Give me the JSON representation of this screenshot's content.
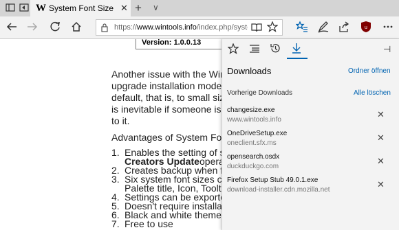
{
  "tab": {
    "logo": "W",
    "title": "System Font Size Chang"
  },
  "toolbar": {
    "tab_icons": [
      "tabs-aside-icon",
      "tab-preview-icon"
    ],
    "new_tab": "+",
    "tab_dropdown": "∨",
    "close_tab": "✕"
  },
  "address": {
    "prefix": "https://",
    "host": "www.wintools.info",
    "path": "/index.php/system-fo"
  },
  "page": {
    "version_label": "Version: 1.0.0.13",
    "lines": [
      "Another issue with the Wind",
      "upgrade installation mode th",
      "default, that is, to small size.",
      "is inevitable if someone is in",
      "to it."
    ],
    "advantages_heading": "Advantages of System Font",
    "list": [
      {
        "num": "1.",
        "text": "Enables the setting of sys",
        "bold_cont": "Creators Update",
        "cont": " operati"
      },
      {
        "num": "2.",
        "text": "Creates backup when firs"
      },
      {
        "num": "3.",
        "text": "Six system font sizes can",
        "cont2": "Palette title, Icon, Tooltip"
      },
      {
        "num": "4.",
        "text": "Settings can be exported"
      },
      {
        "num": "5.",
        "text": "Doesn't require installatio"
      },
      {
        "num": "6.",
        "text": "Black and white theme"
      },
      {
        "num": "7.",
        "text": "Free to use"
      }
    ]
  },
  "hub": {
    "title": "Downloads",
    "open_folder": "Ordner öffnen",
    "section": "Vorherige Downloads",
    "clear_all": "Alle löschen",
    "downloads": [
      {
        "name": "changesize.exe",
        "source": "www.wintools.info"
      },
      {
        "name": "OneDriveSetup.exe",
        "source": "oneclient.sfx.ms"
      },
      {
        "name": "opensearch.osdx",
        "source": "duckduckgo.com"
      },
      {
        "name": "Firefox Setup Stub 49.0.1.exe",
        "source": "download-installer.cdn.mozilla.net"
      }
    ],
    "remove_glyph": "✕",
    "pin_glyph": "⊣"
  },
  "colors": {
    "accent": "#0063b1",
    "hub_bg": "#f3f3f3",
    "tabbar": "#d4d4d4"
  }
}
